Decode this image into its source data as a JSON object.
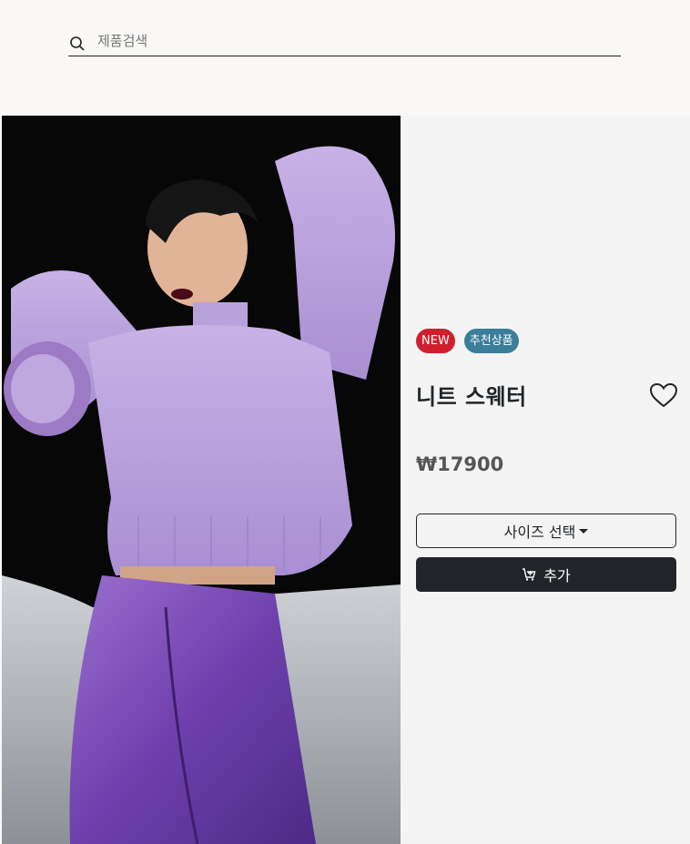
{
  "search": {
    "placeholder": "제품검색",
    "icon": "search-icon"
  },
  "product": {
    "badges": [
      {
        "label": "NEW",
        "color": "#cf1f2e"
      },
      {
        "label": "추천상품",
        "color": "#3a7e9a"
      }
    ],
    "title": "니트 스웨터",
    "price": "₩17900",
    "size_select_label": "사이즈 선택",
    "add_button_label": "추가",
    "wishlist_icon": "heart-icon",
    "cart_icon": "cart-plus-icon"
  }
}
